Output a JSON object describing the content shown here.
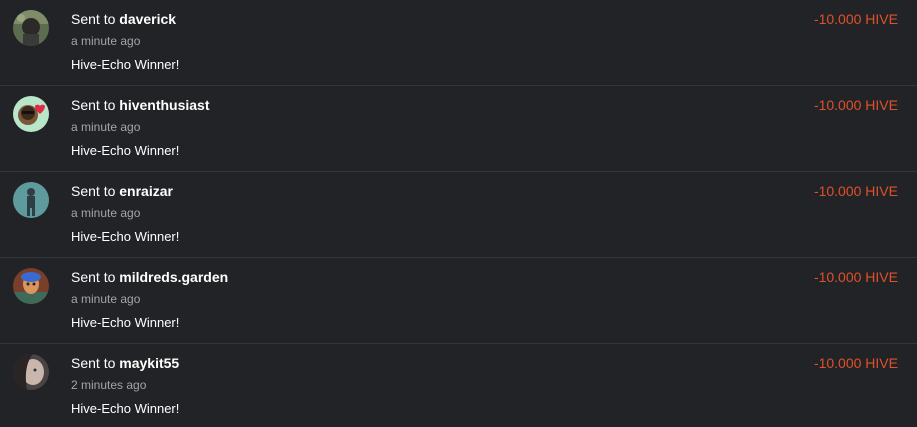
{
  "transfers": [
    {
      "prefix": "Sent to",
      "recipient": "daverick",
      "time": "a minute ago",
      "memo": "Hive-Echo Winner!",
      "amount": "-10.000 HIVE"
    },
    {
      "prefix": "Sent to",
      "recipient": "hiventhusiast",
      "time": "a minute ago",
      "memo": "Hive-Echo Winner!",
      "amount": "-10.000 HIVE"
    },
    {
      "prefix": "Sent to",
      "recipient": "enraizar",
      "time": "a minute ago",
      "memo": "Hive-Echo Winner!",
      "amount": "-10.000 HIVE"
    },
    {
      "prefix": "Sent to",
      "recipient": "mildreds.garden",
      "time": "a minute ago",
      "memo": "Hive-Echo Winner!",
      "amount": "-10.000 HIVE"
    },
    {
      "prefix": "Sent to",
      "recipient": "maykit55",
      "time": "2 minutes ago",
      "memo": "Hive-Echo Winner!",
      "amount": "-10.000 HIVE"
    }
  ],
  "colors": {
    "background": "#222326",
    "amount_negative": "#e0502a",
    "secondary_text": "#a3a5a9",
    "divider": "#34363a"
  }
}
